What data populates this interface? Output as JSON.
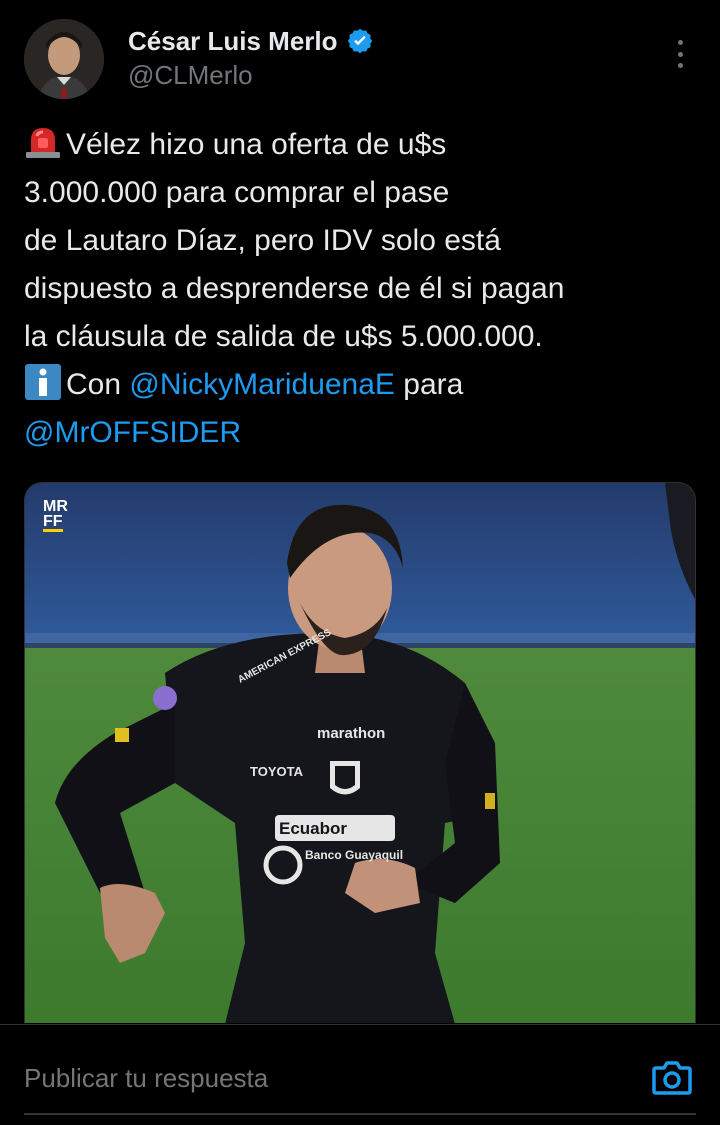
{
  "header": {
    "display_name": "César Luis Merlo",
    "handle": "@CLMerlo",
    "verified": true
  },
  "tweet": {
    "lines": [
      {
        "prefix_emoji": "rotating-light-emoji",
        "text": "Vélez hizo una oferta de u$s"
      },
      {
        "text": "3.000.000 para comprar el pase"
      },
      {
        "text": "de Lautaro Díaz, pero IDV solo está"
      },
      {
        "text": "dispuesto a desprenderse de él si pagan"
      },
      {
        "text": "la cláusula de salida de u$s 5.000.000."
      }
    ],
    "credit_line": {
      "prefix_emoji": "information-emoji",
      "con": "Con",
      "mention_1": "@NickyMariduenaE",
      "para": "para"
    },
    "mention_2": "@MrOFFSIDER"
  },
  "media": {
    "logo_line_1": "MR",
    "logo_line_2": "FF",
    "jersey_texts": [
      "marathon",
      "TOYOTA",
      "Ecuabor",
      "Banco Guayaquil",
      "AMERICAN EXPRESS"
    ]
  },
  "reply": {
    "placeholder": "Publicar tu respuesta"
  },
  "colors": {
    "background": "#000000",
    "text": "#e7e9ea",
    "secondary": "#71767b",
    "accent": "#1d9bf0"
  }
}
